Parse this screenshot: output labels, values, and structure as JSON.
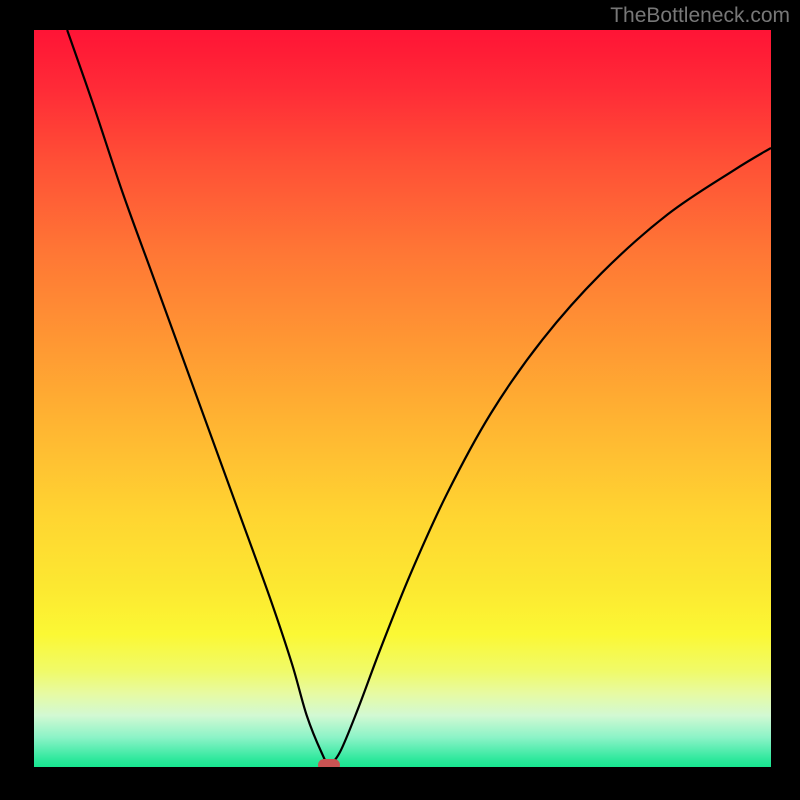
{
  "attribution": "TheBottleneck.com",
  "chart_data": {
    "type": "line",
    "title": "",
    "xlabel": "",
    "ylabel": "",
    "xlim": [
      0,
      100
    ],
    "ylim": [
      0,
      100
    ],
    "grid": false,
    "curve_minimum_x": 40,
    "curve_points": [
      {
        "x": 4.5,
        "y": 100
      },
      {
        "x": 8,
        "y": 90
      },
      {
        "x": 12,
        "y": 78
      },
      {
        "x": 16,
        "y": 67
      },
      {
        "x": 20,
        "y": 56
      },
      {
        "x": 24,
        "y": 45
      },
      {
        "x": 28,
        "y": 34
      },
      {
        "x": 32,
        "y": 23
      },
      {
        "x": 35,
        "y": 14
      },
      {
        "x": 37,
        "y": 7
      },
      {
        "x": 39,
        "y": 2
      },
      {
        "x": 40,
        "y": 0.5
      },
      {
        "x": 41.5,
        "y": 2
      },
      {
        "x": 44,
        "y": 8
      },
      {
        "x": 47,
        "y": 16
      },
      {
        "x": 51,
        "y": 26
      },
      {
        "x": 56,
        "y": 37
      },
      {
        "x": 62,
        "y": 48
      },
      {
        "x": 69,
        "y": 58
      },
      {
        "x": 77,
        "y": 67
      },
      {
        "x": 86,
        "y": 75
      },
      {
        "x": 95,
        "y": 81
      },
      {
        "x": 100,
        "y": 84
      }
    ],
    "marker": {
      "x": 40,
      "y": 0.3
    }
  },
  "colors": {
    "curve": "#000000",
    "marker": "#c95353"
  }
}
